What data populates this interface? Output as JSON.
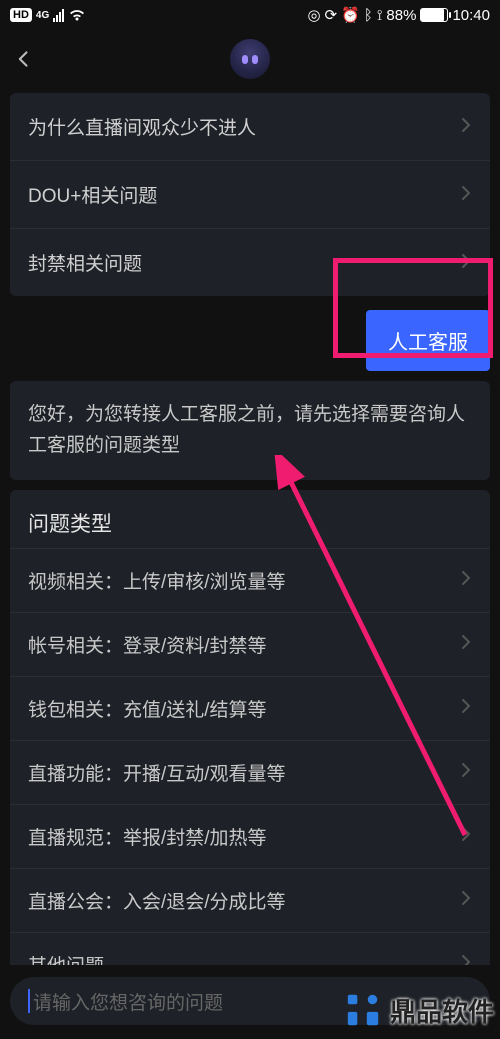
{
  "status": {
    "hd": "HD",
    "net": "4G",
    "battery_pct": "88%",
    "time": "10:40"
  },
  "faq": [
    {
      "label": "为什么直播间观众少不进人"
    },
    {
      "label": "DOU+相关问题"
    },
    {
      "label": "封禁相关问题"
    }
  ],
  "user_msg": "人工客服",
  "sys_msg": "您好，为您转接人工客服之前，请先选择需要咨询人工客服的问题类型",
  "categories": {
    "title": "问题类型",
    "items": [
      {
        "label": "视频相关：上传/审核/浏览量等"
      },
      {
        "label": "帐号相关：登录/资料/封禁等"
      },
      {
        "label": "钱包相关：充值/送礼/结算等"
      },
      {
        "label": "直播功能：开播/互动/观看量等"
      },
      {
        "label": "直播规范：举报/封禁/加热等"
      },
      {
        "label": "直播公会：入会/退会/分成比等"
      },
      {
        "label": "其他问题"
      }
    ]
  },
  "input": {
    "placeholder": "请输入您想咨询的问题"
  },
  "watermark": "鼎品软件"
}
